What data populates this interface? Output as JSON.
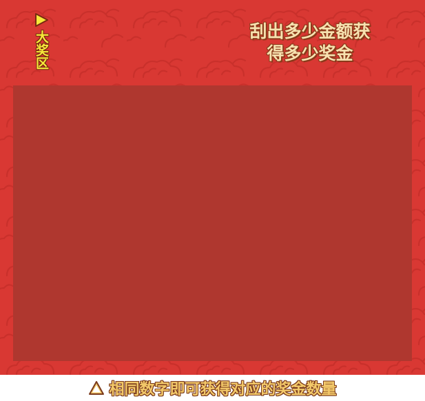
{
  "prize_zone": {
    "label": "大奖区",
    "pointer_icon": "play-triangle-icon"
  },
  "headline": {
    "line1": "刮出多少金额获",
    "line2": "得多少奖金"
  },
  "scratch_area": {
    "icon": "scratch-cover"
  },
  "footer": {
    "icon": "warning-triangle-icon",
    "text": "相同数字即可获得对应的奖金数量"
  },
  "colors": {
    "background": "#d93833",
    "scratch_cover": "#af372f",
    "label_yellow": "#f6e83a",
    "headline_cream": "#f7e2b0",
    "footer_gold": "#f3c96a"
  }
}
